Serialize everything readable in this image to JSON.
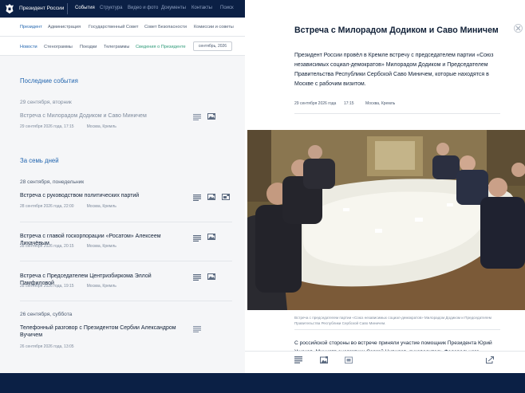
{
  "site": {
    "name": "Президент России",
    "top_nav": [
      "События",
      "Структура",
      "Видео и фото",
      "Документы",
      "Контакты",
      "Поиск"
    ]
  },
  "sub_nav": [
    "Президент",
    "Администрация",
    "Государственный Совет",
    "Совет Безопасности",
    "Комиссии и советы"
  ],
  "tabs": [
    "Новости",
    "Стенограммы",
    "Поездки",
    "Телеграммы",
    "Сведения о Президенте"
  ],
  "date_filter": "сентябрь, 2026",
  "recent": {
    "title": "Последние события",
    "date": "29 сентября, вторник",
    "event": {
      "title": "Встреча с Милорадом Додиком и Саво Миничем",
      "time": "29 сентября 2026 года, 17:15",
      "location": "Москва, Кремль"
    }
  },
  "week": {
    "title": "За семь дней",
    "day1": "28 сентября, понедельник",
    "day2": "26 сентября, суббота",
    "events": [
      {
        "title": "Встреча с руководством политических партий",
        "time": "28 сентября 2026 года, 22:00",
        "location": "Москва, Кремль"
      },
      {
        "title": "Встреча с главой госкорпорации «Росатом» Алексеем Лихачёвым",
        "time": "28 сентября 2026 года, 20:15",
        "location": "Москва, Кремль"
      },
      {
        "title": "Встреча с Председателем Центризбиркома Эллой Памфиловой",
        "time": "28 сентября 2026 года, 19:15",
        "location": "Москва, Кремль"
      },
      {
        "title": "Телефонный разговор с Президентом Сербии Александром Вучичем",
        "time": "26 сентября 2026 года, 13:05",
        "location": ""
      }
    ]
  },
  "article": {
    "title": "Встреча с Милорадом Додиком и Саво Миничем",
    "lead": "Президент России провёл в Кремле встречу с председателем партии «Союз независимых социал-демократов» Милорадом Додиком и Председателем Правительства Республики Сербской Саво Миничем, которые находятся в Москве с рабочим визитом.",
    "date": "29 сентября 2026 года",
    "time": "17:15",
    "location": "Москва, Кремль",
    "caption": "Встреча с председателем партии «Союз независимых социал-демократов» Милорадом Додиком и Председателем Правительства Республики Сербской Саво Миничем.",
    "body": "С российской стороны во встрече приняли участие помощник Президента Юрий Ушаков, Министр энергетики Сергей Цивилев, руководитель Федерального"
  },
  "icons": {
    "logo": "eagle-icon",
    "transcript": "list-icon",
    "photo": "photo-icon",
    "video": "video-icon",
    "share": "share-icon",
    "close": "close-icon"
  },
  "colors": {
    "navy": "#0b2045",
    "link": "#2467b0",
    "accent_green": "#2e9a78",
    "text": "#0f1f36",
    "muted": "#7d8a9c"
  }
}
